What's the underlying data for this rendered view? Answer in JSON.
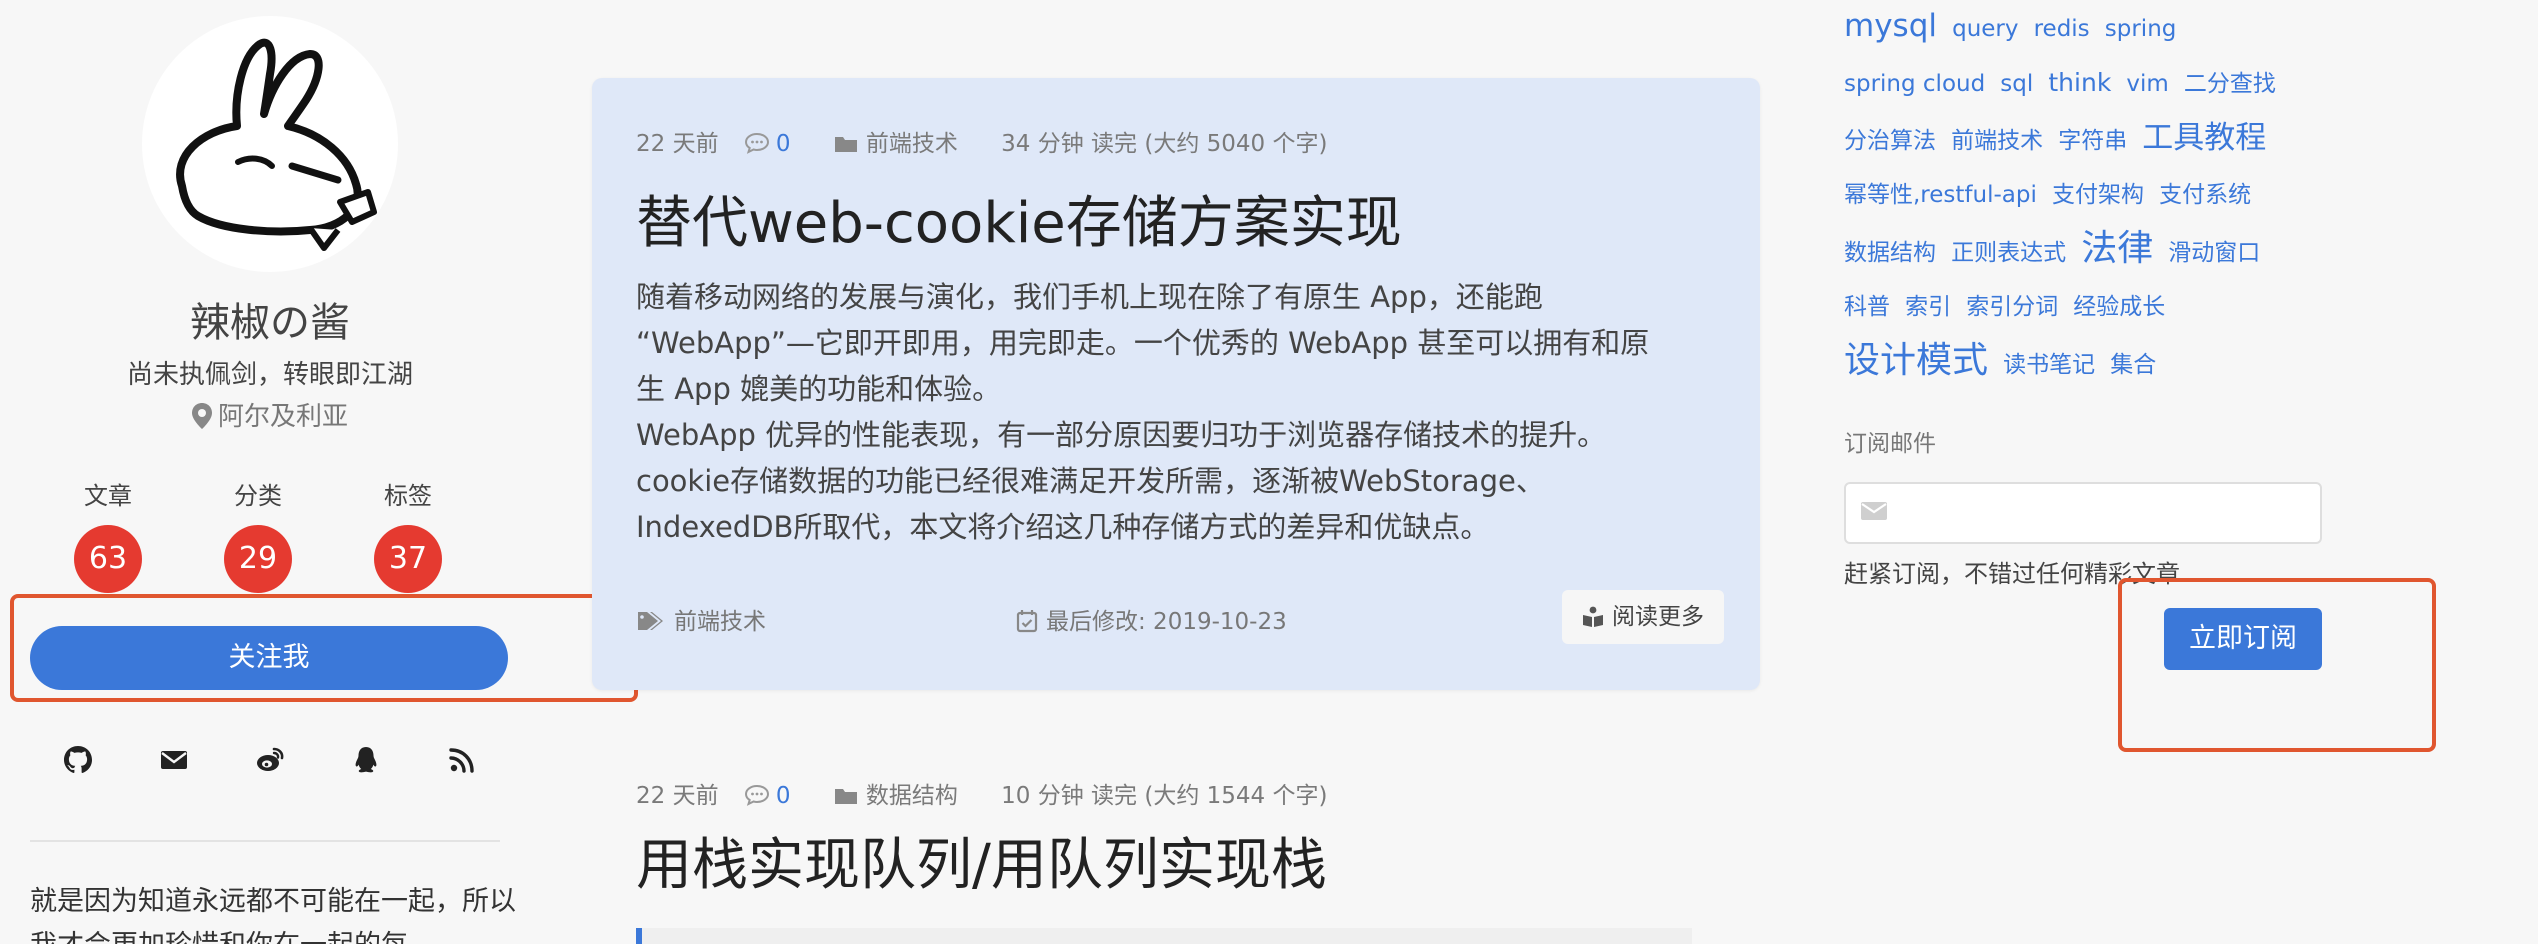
{
  "profile": {
    "name": "辣椒の酱",
    "motto": "尚未执佩剑，转眼即江湖",
    "location": "阿尔及利亚",
    "stats": [
      {
        "label": "文章",
        "count": "63"
      },
      {
        "label": "分类",
        "count": "29"
      },
      {
        "label": "标签",
        "count": "37"
      }
    ],
    "follow_label": "关注我",
    "social_icons": [
      "github-icon",
      "email-icon",
      "weibo-icon",
      "qq-icon",
      "rss-icon"
    ],
    "quote": "就是因为知道永远都不可能在一起，所以我才会更加珍惜和你在一起的每"
  },
  "posts": [
    {
      "time": "22 天前",
      "comments": "0",
      "category": "前端技术",
      "read_time": "34 分钟 读完 (大约 5040 个字)",
      "title": "替代web-cookie存储方案实现",
      "excerpt": [
        "随着移动网络的发展与演化，我们手机上现在除了有原生 App，还能跑",
        "“WebApp”—它即开即用，用完即走。一个优秀的 WebApp 甚至可以拥有和原",
        "生 App 媲美的功能和体验。",
        "WebApp 优异的性能表现，有一部分原因要归功于浏览器存储技术的提升。",
        "cookie存储数据的功能已经很难满足开发所需，逐渐被WebStorage、",
        "IndexedDB所取代，本文将介绍这几种存储方式的差异和优缺点。"
      ],
      "tag": "前端技术",
      "modified": "最后修改: 2019-10-23",
      "read_more": "阅读更多"
    },
    {
      "time": "22 天前",
      "comments": "0",
      "category": "数据结构",
      "read_time": "10 分钟 读完 (大约 1544 个字)",
      "title": "用栈实现队列/用队列实现栈"
    }
  ],
  "tagcloud": {
    "tags": [
      {
        "text": "mysql",
        "size": "s3"
      },
      {
        "text": "query",
        "size": "s1"
      },
      {
        "text": "redis",
        "size": "s1"
      },
      {
        "text": "spring",
        "size": "s1"
      },
      {
        "text": "spring cloud",
        "size": "s1"
      },
      {
        "text": "sql",
        "size": "s1"
      },
      {
        "text": "think",
        "size": "s2"
      },
      {
        "text": "vim",
        "size": "s1"
      },
      {
        "text": "二分查找",
        "size": "s1"
      },
      {
        "text": "分治算法",
        "size": "s1"
      },
      {
        "text": "前端技术",
        "size": "s1"
      },
      {
        "text": "字符串",
        "size": "s1"
      },
      {
        "text": "工具教程",
        "size": "s3"
      },
      {
        "text": "幂等性,restful-api",
        "size": "s1"
      },
      {
        "text": "支付架构",
        "size": "s1"
      },
      {
        "text": "支付系统",
        "size": "s1"
      },
      {
        "text": "数据结构",
        "size": "s1"
      },
      {
        "text": "正则表达式",
        "size": "s1"
      },
      {
        "text": "法律",
        "size": "s4"
      },
      {
        "text": "滑动窗口",
        "size": "s1"
      },
      {
        "text": "科普",
        "size": "s1"
      },
      {
        "text": "索引",
        "size": "s1"
      },
      {
        "text": "索引分词",
        "size": "s1"
      },
      {
        "text": "经验成长",
        "size": "s1"
      },
      {
        "text": "设计模式",
        "size": "s4"
      },
      {
        "text": "读书笔记",
        "size": "s1"
      },
      {
        "text": "集合",
        "size": "s1"
      }
    ]
  },
  "subscribe": {
    "label": "订阅邮件",
    "placeholder": "",
    "hint": "赶紧订阅，不错过任何精彩文章",
    "button": "立即订阅"
  },
  "colors": {
    "accent": "#3b78d9",
    "badge": "#e53a30",
    "highlight": "#e0562f",
    "card": "#dfe8f8"
  }
}
